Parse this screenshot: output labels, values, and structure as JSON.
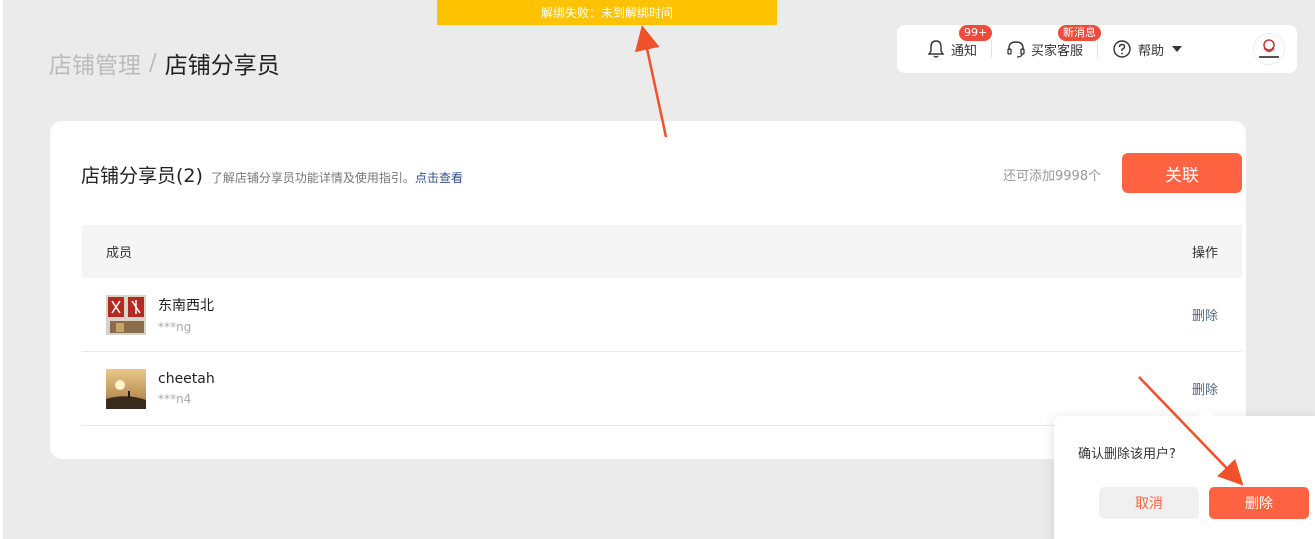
{
  "toast": {
    "text": "解绑失败：未到解绑时间"
  },
  "breadcrumb": {
    "parent": "店铺管理",
    "separator": "/",
    "current": "店铺分享员"
  },
  "topbar": {
    "notify_label": "通知",
    "notify_badge": "99+",
    "service_label": "买家客服",
    "service_badge": "新消息",
    "help_label": "帮助"
  },
  "card": {
    "title": "店铺分享员(2)",
    "desc": "了解店铺分享员功能详情及使用指引。",
    "link": "点击查看",
    "remaining": "还可添加9998个",
    "associate_button": "关联"
  },
  "table": {
    "columns": [
      "成员",
      "操作"
    ],
    "rows": [
      {
        "name": "东南西北",
        "account": "***ng",
        "action": "删除"
      },
      {
        "name": "cheetah",
        "account": "***n4",
        "action": "删除"
      }
    ]
  },
  "popconfirm": {
    "message": "确认删除该用户?",
    "cancel": "取消",
    "confirm": "删除"
  },
  "colors": {
    "accent": "#ff6341",
    "toast": "#ffc200",
    "badge": "#f04b3d",
    "link": "#33508a"
  }
}
